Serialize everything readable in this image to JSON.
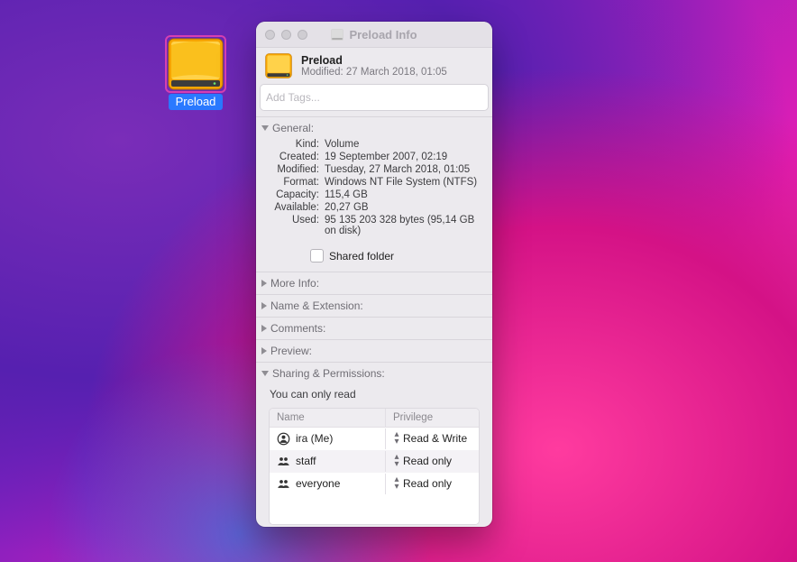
{
  "desktop_icon": {
    "label": "Preload"
  },
  "window": {
    "title": "Preload Info",
    "header_name": "Preload",
    "header_modified_label": "Modified:",
    "header_modified_value": "27 March 2018, 01:05",
    "tags_placeholder": "Add Tags...",
    "sections": {
      "general": {
        "title": "General:",
        "kind_label": "Kind:",
        "kind_value": "Volume",
        "created_label": "Created:",
        "created_value": "19 September 2007, 02:19",
        "modified_label": "Modified:",
        "modified_value": "Tuesday, 27 March 2018, 01:05",
        "format_label": "Format:",
        "format_value": "Windows NT File System (NTFS)",
        "capacity_label": "Capacity:",
        "capacity_value": "115,4 GB",
        "available_label": "Available:",
        "available_value": "20,27 GB",
        "used_label": "Used:",
        "used_value": "95 135 203 328 bytes (95,14 GB on disk)",
        "shared_folder_label": "Shared folder"
      },
      "more_info": "More Info:",
      "name_ext": "Name & Extension:",
      "comments": "Comments:",
      "preview": "Preview:",
      "sharing": {
        "title": "Sharing & Permissions:",
        "note": "You can only read",
        "col_name": "Name",
        "col_priv": "Privilege",
        "rows": [
          {
            "name": "ira (Me)",
            "priv": "Read & Write"
          },
          {
            "name": "staff",
            "priv": "Read only"
          },
          {
            "name": "everyone",
            "priv": "Read only"
          }
        ]
      }
    }
  }
}
